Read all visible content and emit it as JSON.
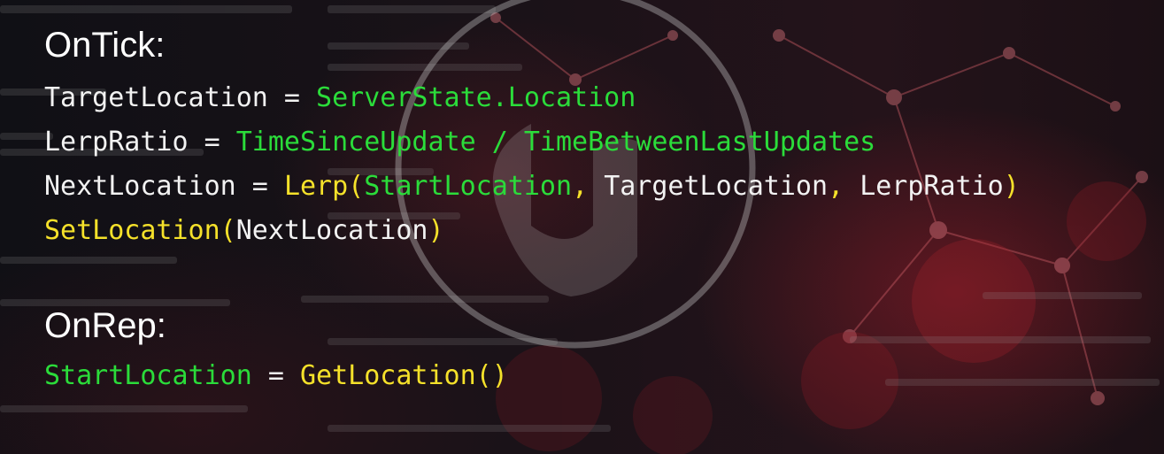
{
  "colors": {
    "text": "#f2f2f2",
    "identifier": "#2bdc3a",
    "function": "#f5e12a",
    "background": "#120f14",
    "accent": "#96202a"
  },
  "background": {
    "logo": "unreal-engine-logo",
    "texture": "blurred source code and molecule network"
  },
  "sections": [
    {
      "title": "OnTick:",
      "lines": [
        [
          {
            "text": "TargetLocation = ",
            "color": "white"
          },
          {
            "text": "ServerState.Location",
            "color": "green"
          }
        ],
        [
          {
            "text": "LerpRatio = ",
            "color": "white"
          },
          {
            "text": "TimeSinceUpdate / TimeBetweenLastUpdates",
            "color": "green"
          }
        ],
        [
          {
            "text": "NextLocation = ",
            "color": "white"
          },
          {
            "text": "Lerp(",
            "color": "yellow"
          },
          {
            "text": "StartLocation",
            "color": "green"
          },
          {
            "text": ", ",
            "color": "yellow"
          },
          {
            "text": "TargetLocation",
            "color": "white"
          },
          {
            "text": ", ",
            "color": "yellow"
          },
          {
            "text": "LerpRatio",
            "color": "white"
          },
          {
            "text": ")",
            "color": "yellow"
          }
        ],
        [
          {
            "text": "SetLocation(",
            "color": "yellow"
          },
          {
            "text": "NextLocation",
            "color": "white"
          },
          {
            "text": ")",
            "color": "yellow"
          }
        ]
      ]
    },
    {
      "title": "OnRep:",
      "lines": [
        [
          {
            "text": "StartLocation",
            "color": "green"
          },
          {
            "text": " = ",
            "color": "white"
          },
          {
            "text": "GetLocation()",
            "color": "yellow"
          }
        ]
      ]
    }
  ]
}
